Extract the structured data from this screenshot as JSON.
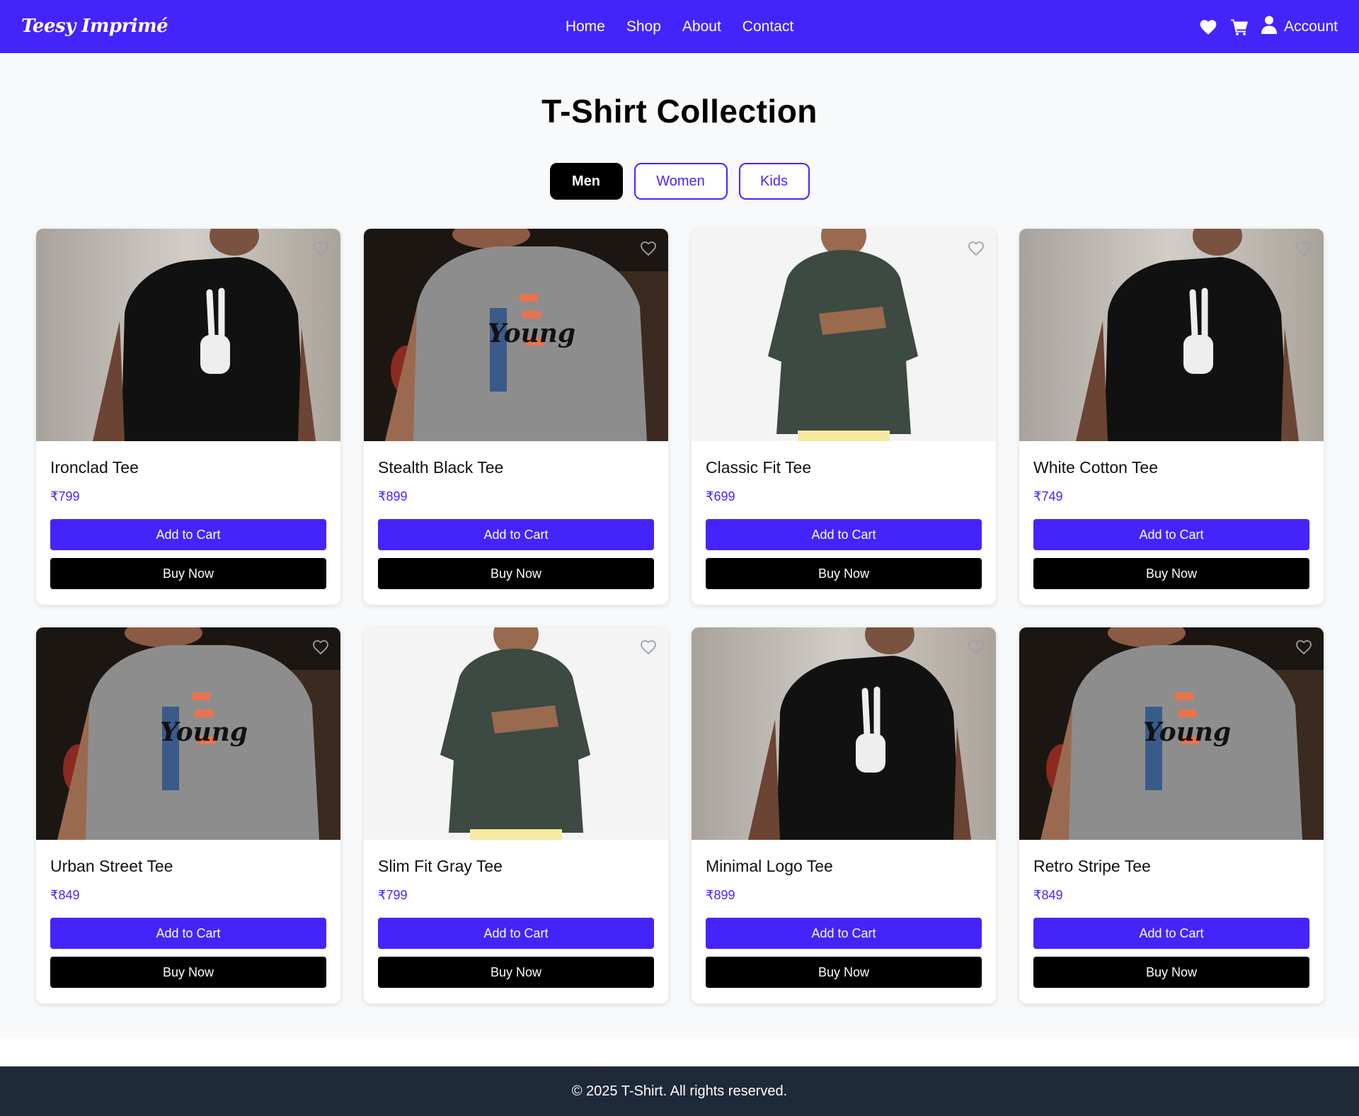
{
  "header": {
    "brand": "Teesy Imprimé",
    "nav": [
      "Home",
      "Shop",
      "About",
      "Contact"
    ],
    "account_label": "Account"
  },
  "main": {
    "title": "T-Shirt Collection",
    "tabs": [
      {
        "label": "Men",
        "active": true
      },
      {
        "label": "Women",
        "active": false
      },
      {
        "label": "Kids",
        "active": false
      }
    ]
  },
  "products": [
    {
      "name": "Ironclad Tee",
      "price": "₹799",
      "image": "black-skeleton-peace-tee",
      "add_label": "Add to Cart",
      "buy_label": "Buy Now"
    },
    {
      "name": "Stealth Black Tee",
      "price": "₹899",
      "image": "gray-young-graphic-tee",
      "add_label": "Add to Cart",
      "buy_label": "Buy Now"
    },
    {
      "name": "Classic Fit Tee",
      "price": "₹699",
      "image": "green-camo-tee",
      "add_label": "Add to Cart",
      "buy_label": "Buy Now"
    },
    {
      "name": "White Cotton Tee",
      "price": "₹749",
      "image": "black-skeleton-peace-tee",
      "add_label": "Add to Cart",
      "buy_label": "Buy Now"
    },
    {
      "name": "Urban Street Tee",
      "price": "₹849",
      "image": "gray-young-graphic-tee",
      "add_label": "Add to Cart",
      "buy_label": "Buy Now"
    },
    {
      "name": "Slim Fit Gray Tee",
      "price": "₹799",
      "image": "green-camo-tee",
      "add_label": "Add to Cart",
      "buy_label": "Buy Now"
    },
    {
      "name": "Minimal Logo Tee",
      "price": "₹899",
      "image": "black-skeleton-peace-tee",
      "add_label": "Add to Cart",
      "buy_label": "Buy Now"
    },
    {
      "name": "Retro Stripe Tee",
      "price": "₹849",
      "image": "gray-young-graphic-tee",
      "add_label": "Add to Cart",
      "buy_label": "Buy Now"
    }
  ],
  "footer": {
    "text": "© 2025 T-Shirt. All rights reserved."
  },
  "colors": {
    "accent": "#4424fb",
    "footer_bg": "#1e2939",
    "page_bg": "#f8f9fb",
    "buy_button": "#000000"
  }
}
